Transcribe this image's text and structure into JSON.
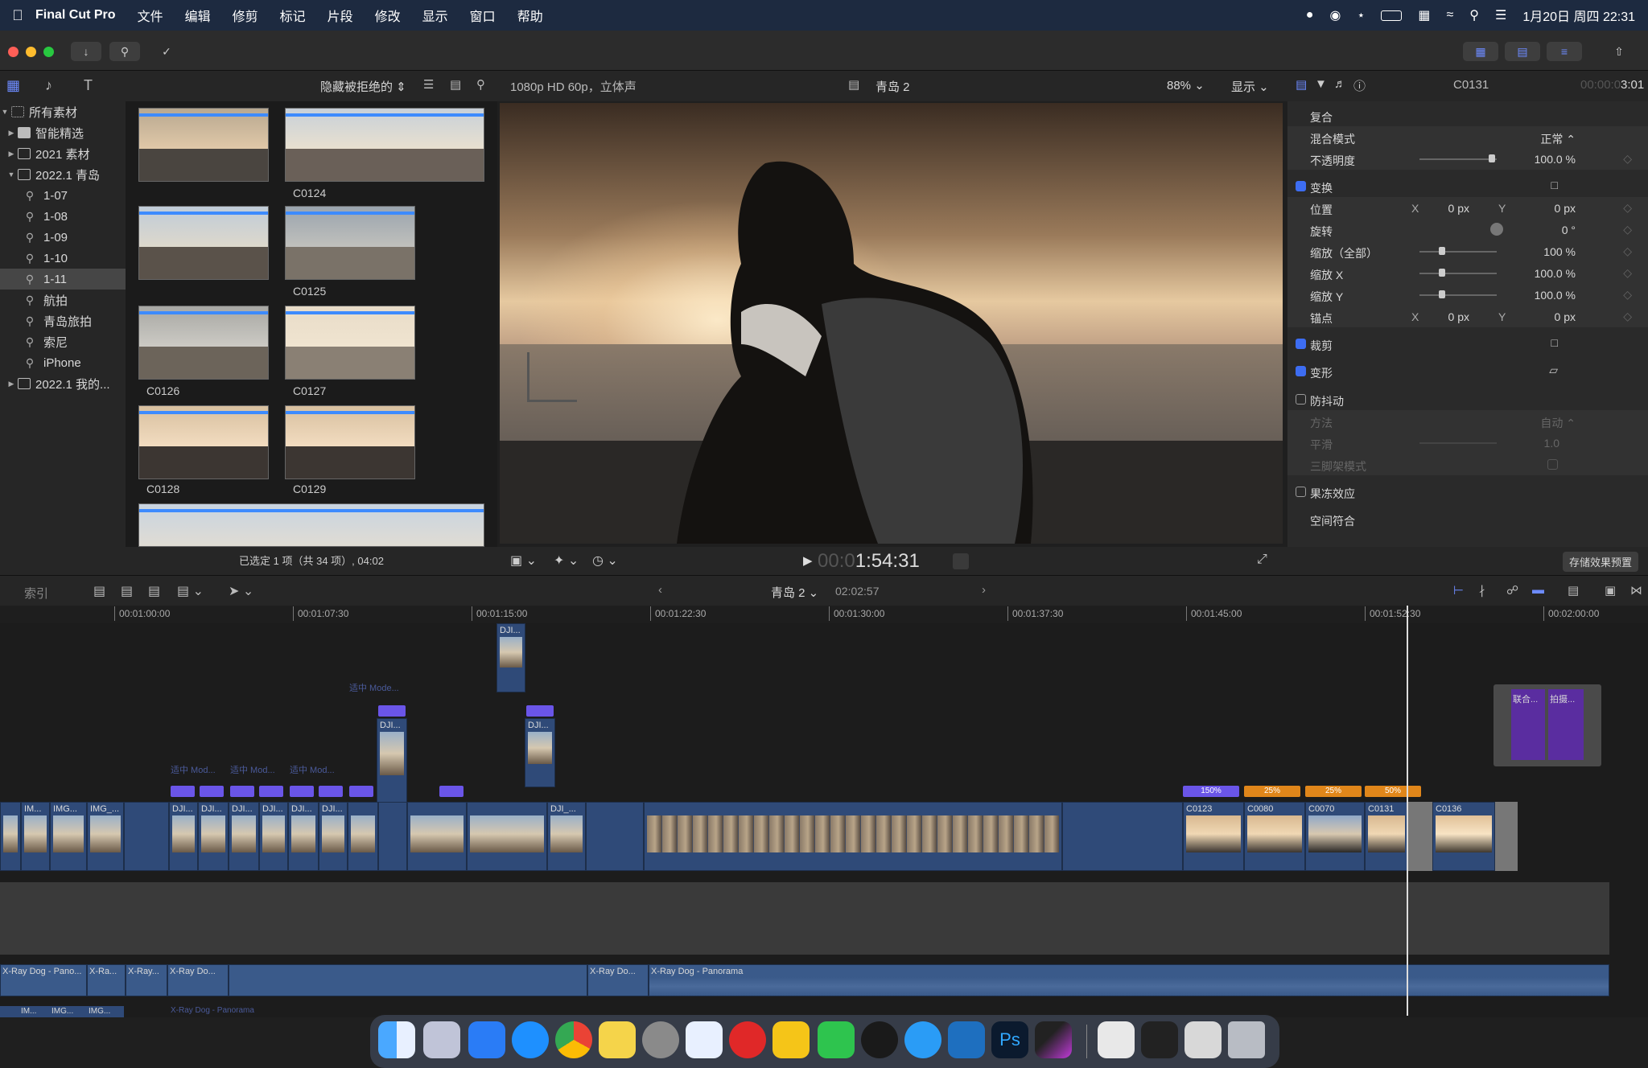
{
  "menubar": {
    "app": "Final Cut Pro",
    "items": [
      "文件",
      "编辑",
      "修剪",
      "标记",
      "片段",
      "修改",
      "显示",
      "窗口",
      "帮助"
    ],
    "clock": "1月20日 周四 22:31"
  },
  "sidebar": {
    "items": [
      {
        "label": "所有素材",
        "kind": "grid",
        "indent": 0,
        "tri": "▼"
      },
      {
        "label": "智能精选",
        "kind": "folder",
        "indent": 1,
        "tri": "▶"
      },
      {
        "label": "2021 素材",
        "kind": "event",
        "indent": 1,
        "tri": "▶"
      },
      {
        "label": "2022.1 青岛",
        "kind": "event",
        "indent": 1,
        "tri": "▼"
      },
      {
        "label": "1-07",
        "kind": "keyword",
        "indent": 2,
        "tri": ""
      },
      {
        "label": "1-08",
        "kind": "keyword",
        "indent": 2,
        "tri": ""
      },
      {
        "label": "1-09",
        "kind": "keyword",
        "indent": 2,
        "tri": ""
      },
      {
        "label": "1-10",
        "kind": "keyword",
        "indent": 2,
        "tri": ""
      },
      {
        "label": "1-11",
        "kind": "keyword",
        "indent": 2,
        "tri": "",
        "selected": true
      },
      {
        "label": "航拍",
        "kind": "keyword",
        "indent": 2,
        "tri": ""
      },
      {
        "label": "青岛旅拍",
        "kind": "keyword",
        "indent": 2,
        "tri": ""
      },
      {
        "label": "索尼",
        "kind": "keyword",
        "indent": 2,
        "tri": ""
      },
      {
        "label": "iPhone",
        "kind": "keyword",
        "indent": 2,
        "tri": ""
      },
      {
        "label": "2022.1 我的...",
        "kind": "event",
        "indent": 1,
        "tri": "▶"
      }
    ]
  },
  "browser": {
    "filter_label": "隐藏被拒绝的",
    "clips": [
      {
        "label": "C0124"
      },
      {
        "label": "C0125"
      },
      {
        "label": "C0126"
      },
      {
        "label": "C0127"
      },
      {
        "label": "C0128"
      },
      {
        "label": "C0129"
      }
    ],
    "footer": "已选定 1 项（共 34 项）, 04:02"
  },
  "viewer": {
    "format": "1080p HD 60p，立体声",
    "project": "青岛 2",
    "zoom": "88%",
    "display": "显示",
    "timecode_dim": "00:0",
    "timecode": "1:54:31"
  },
  "inspector": {
    "clip_name": "C0131",
    "duration_dim": "00:00:0",
    "duration": "3:01",
    "rows": {
      "compositing": "复合",
      "blend_mode": "混合模式",
      "blend_mode_value": "正常 ⌃",
      "opacity": "不透明度",
      "opacity_value": "100.0  %",
      "transform": "变换",
      "position": "位置",
      "position_x": "0  px",
      "position_y": "0  px",
      "rotation": "旋转",
      "rotation_value": "0  °",
      "scale_all": "缩放（全部）",
      "scale_all_value": "100  %",
      "scale_x": "缩放 X",
      "scale_x_value": "100.0  %",
      "scale_y": "缩放 Y",
      "scale_y_value": "100.0  %",
      "anchor": "锚点",
      "anchor_x": "0  px",
      "anchor_y": "0  px",
      "crop": "裁剪",
      "distort": "变形",
      "stabilization": "防抖动",
      "method": "方法",
      "method_value": "自动 ⌃",
      "smoothing": "平滑",
      "smoothing_value": "1.0",
      "tripod": "三脚架模式",
      "rolling_shutter": "果冻效应",
      "spatial_conform": "空间符合",
      "axis_x": "X",
      "axis_y": "Y"
    },
    "save_preset": "存储效果预置"
  },
  "timeline": {
    "index_label": "索引",
    "project": "青岛 2",
    "duration": "02:02:57",
    "ruler": [
      "00:01:00:00",
      "00:01:07:30",
      "00:01:15:00",
      "00:01:22:30",
      "00:01:30:00",
      "00:01:37:30",
      "00:01:45:00",
      "00:01:52:30",
      "00:02:00:00"
    ],
    "main_clips": [
      "IM...",
      "IMG...",
      "IMG_...",
      "DJI...",
      "DJI...",
      "DJI...",
      "DJI...",
      "DJI...",
      "DJI...",
      "DJI...",
      "DJI...",
      "DJI...",
      "DJI_...",
      "C0123",
      "C0080",
      "C0070",
      "C0131",
      "C0136"
    ],
    "speed_tags": [
      "150%",
      "25%",
      "25%",
      "50%"
    ],
    "connected_labels": [
      "适中 Mode...",
      "适中 Mod...",
      "适中 Mod...",
      "适中 Mod...",
      "联合...",
      "拍摄..."
    ],
    "audio_label": "X-Ray Dog - Panorama",
    "audio_short": [
      "X-Ray Dog - Pano...",
      "X-Ra...",
      "X-Ray...",
      "X-Ray Do...",
      "X-Ray Do..."
    ],
    "lower_labels": [
      "IM...",
      "IMG...",
      "IMG...",
      "X-Ray Dog - Panorama"
    ]
  },
  "colors": {
    "accent": "#3d6df2",
    "clip_blue": "#2f4a78",
    "tag_purple": "#6a55e8",
    "tag_orange": "#e0861a"
  }
}
